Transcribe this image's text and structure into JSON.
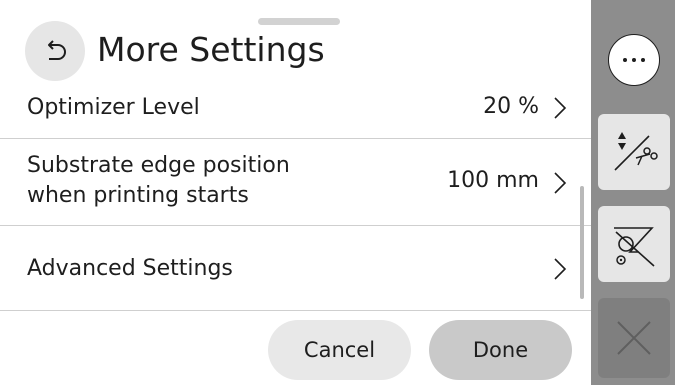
{
  "header": {
    "title": "More Settings",
    "back_icon": "back-arrow-icon"
  },
  "settings": [
    {
      "label": "Optimizer Level",
      "value": "20 %"
    },
    {
      "label": "Substrate edge position\nwhen printing starts",
      "value": "100 mm"
    },
    {
      "label": "Advanced Settings",
      "value": ""
    }
  ],
  "footer": {
    "cancel_label": "Cancel",
    "done_label": "Done"
  },
  "sidebar": {
    "items": [
      {
        "name": "more-options",
        "icon": "ellipsis-icon"
      },
      {
        "name": "form-feed-and-cut",
        "icon": "feed-cut-icon"
      },
      {
        "name": "unload-substrate",
        "icon": "unload-substrate-icon"
      },
      {
        "name": "close",
        "icon": "close-icon"
      }
    ]
  },
  "colors": {
    "sidebar_bg": "#8d8d8d",
    "button_light": "#e8e8e8",
    "button_done": "#c9c9c9",
    "text": "#1e1e1e"
  }
}
